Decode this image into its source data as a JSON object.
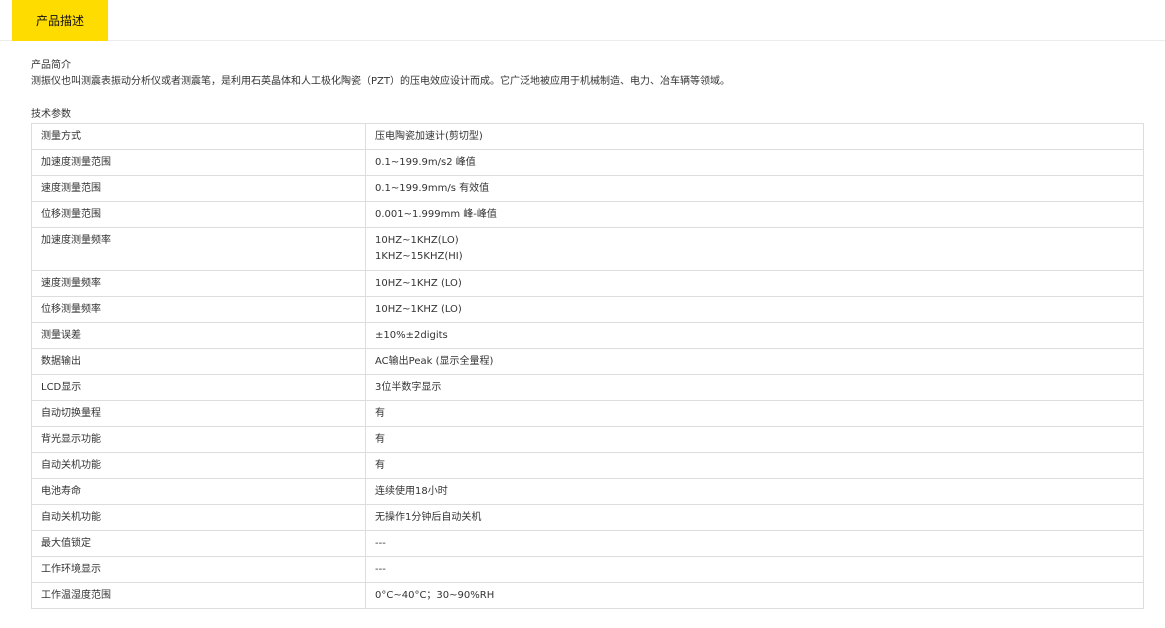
{
  "tabs": {
    "active_label": "产品描述"
  },
  "intro": {
    "title": "产品简介",
    "text": "测振仪也叫测震表振动分析仪或者测震笔，是利用石英晶体和人工极化陶瓷（PZT）的压电效应设计而成。它广泛地被应用于机械制造、电力、冶车辆等领域。"
  },
  "params": {
    "title": "技术参数",
    "rows": [
      {
        "label": "测量方式",
        "value": [
          "压电陶瓷加速计(剪切型)"
        ]
      },
      {
        "label": "加速度测量范围",
        "value": [
          "0.1~199.9m/s2 峰值"
        ]
      },
      {
        "label": "速度测量范围",
        "value": [
          "0.1~199.9mm/s 有效值"
        ]
      },
      {
        "label": "位移测量范围",
        "value": [
          "0.001~1.999mm 峰-峰值"
        ]
      },
      {
        "label": "加速度测量频率",
        "value": [
          "10HZ~1KHZ(LO)",
          "1KHZ~15KHZ(HI)"
        ]
      },
      {
        "label": "速度测量频率",
        "value": [
          "10HZ~1KHZ (LO)"
        ]
      },
      {
        "label": "位移测量频率",
        "value": [
          "10HZ~1KHZ (LO)"
        ]
      },
      {
        "label": "测量误差",
        "value": [
          "±10%±2digits"
        ]
      },
      {
        "label": "数据输出",
        "value": [
          "AC输出Peak (显示全量程)"
        ]
      },
      {
        "label": "LCD显示",
        "value": [
          "3位半数字显示"
        ]
      },
      {
        "label": "自动切换量程",
        "value": [
          "有"
        ]
      },
      {
        "label": "背光显示功能",
        "value": [
          "有"
        ]
      },
      {
        "label": "自动关机功能",
        "value": [
          "有"
        ]
      },
      {
        "label": "电池寿命",
        "value": [
          "连续使用18小时"
        ]
      },
      {
        "label": "自动关机功能",
        "value": [
          "无操作1分钟后自动关机"
        ]
      },
      {
        "label": "最大值锁定",
        "value": [
          "---"
        ]
      },
      {
        "label": "工作环境显示",
        "value": [
          "---"
        ]
      },
      {
        "label": "工作温湿度范围",
        "value": [
          "0°C~40°C；30~90%RH"
        ]
      }
    ]
  }
}
